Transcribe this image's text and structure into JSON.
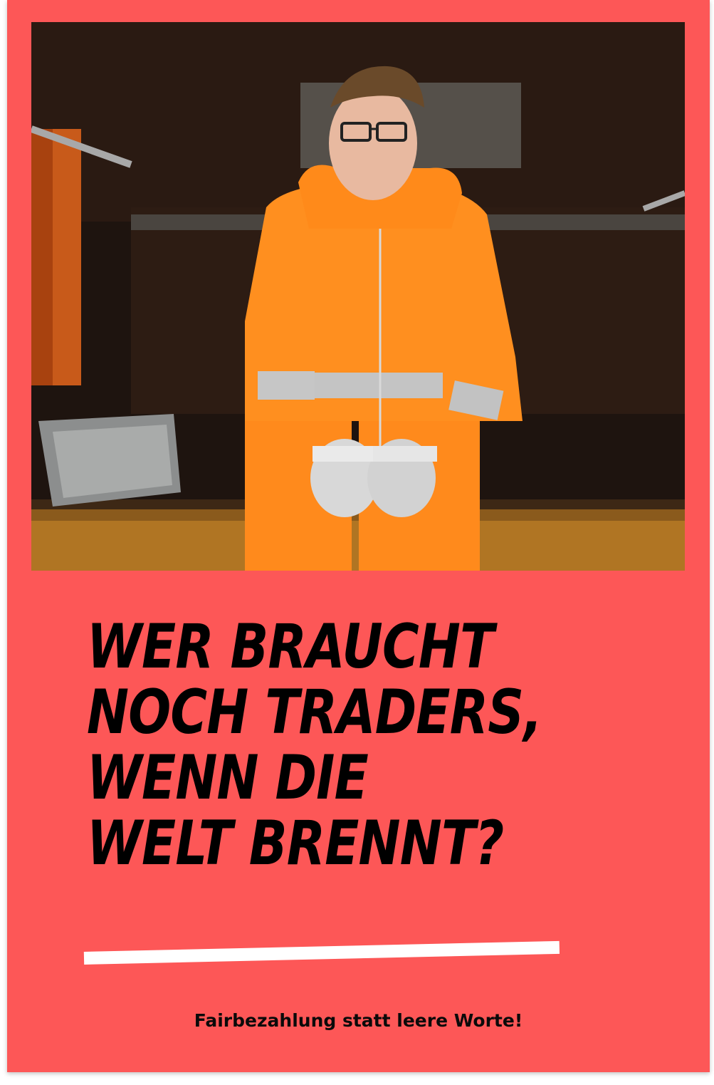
{
  "poster": {
    "background_color": "#fd5757",
    "headline_lines": [
      "WER BRAUCHT",
      "NOCH TRADERS,",
      "WENN DIE",
      "WELT BRENNT?"
    ],
    "tagline": "Fairbezahlung statt leere Worte!",
    "accent_underline_color": "#ffffff"
  }
}
